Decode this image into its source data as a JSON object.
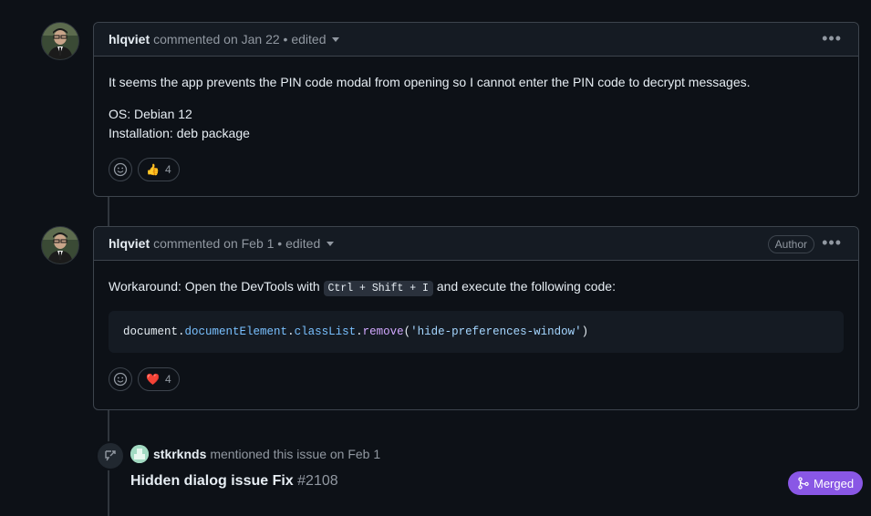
{
  "comments": [
    {
      "author": "hlqviet",
      "meta": "commented on Jan 22 • edited",
      "paragraph": "It seems the app prevents the PIN code modal from opening so I cannot enter the PIN code to decrypt messages.",
      "line1": "OS: Debian 12",
      "line2": "Installation: deb package",
      "reaction_emoji": "👍",
      "reaction_count": "4"
    },
    {
      "author": "hlqviet",
      "meta": "commented on Feb 1 • edited",
      "badge": "Author",
      "text_before": "Workaround: Open the DevTools with ",
      "kbd": "Ctrl + Shift + I",
      "text_after": " and execute the following code:",
      "code": {
        "t1": "document",
        "t2": ".",
        "t3": "documentElement",
        "t4": ".",
        "t5": "classList",
        "t6": ".",
        "t7": "remove",
        "t8": "(",
        "t9": "'hide-preferences-window'",
        "t10": ")"
      },
      "reaction_emoji": "❤️",
      "reaction_count": "4"
    }
  ],
  "event": {
    "user": "stkrknds",
    "text": "mentioned this issue on Feb 1",
    "ref_title": "Hidden dialog issue Fix",
    "ref_number": "#2108",
    "status": "Merged"
  },
  "colors": {
    "accent_merged": "#8957e5",
    "link_blue": "#79c0ff"
  },
  "icons": [
    "avatar-image",
    "kebab-menu-icon",
    "smiley-icon",
    "cross-reference-icon",
    "git-merge-icon"
  ]
}
